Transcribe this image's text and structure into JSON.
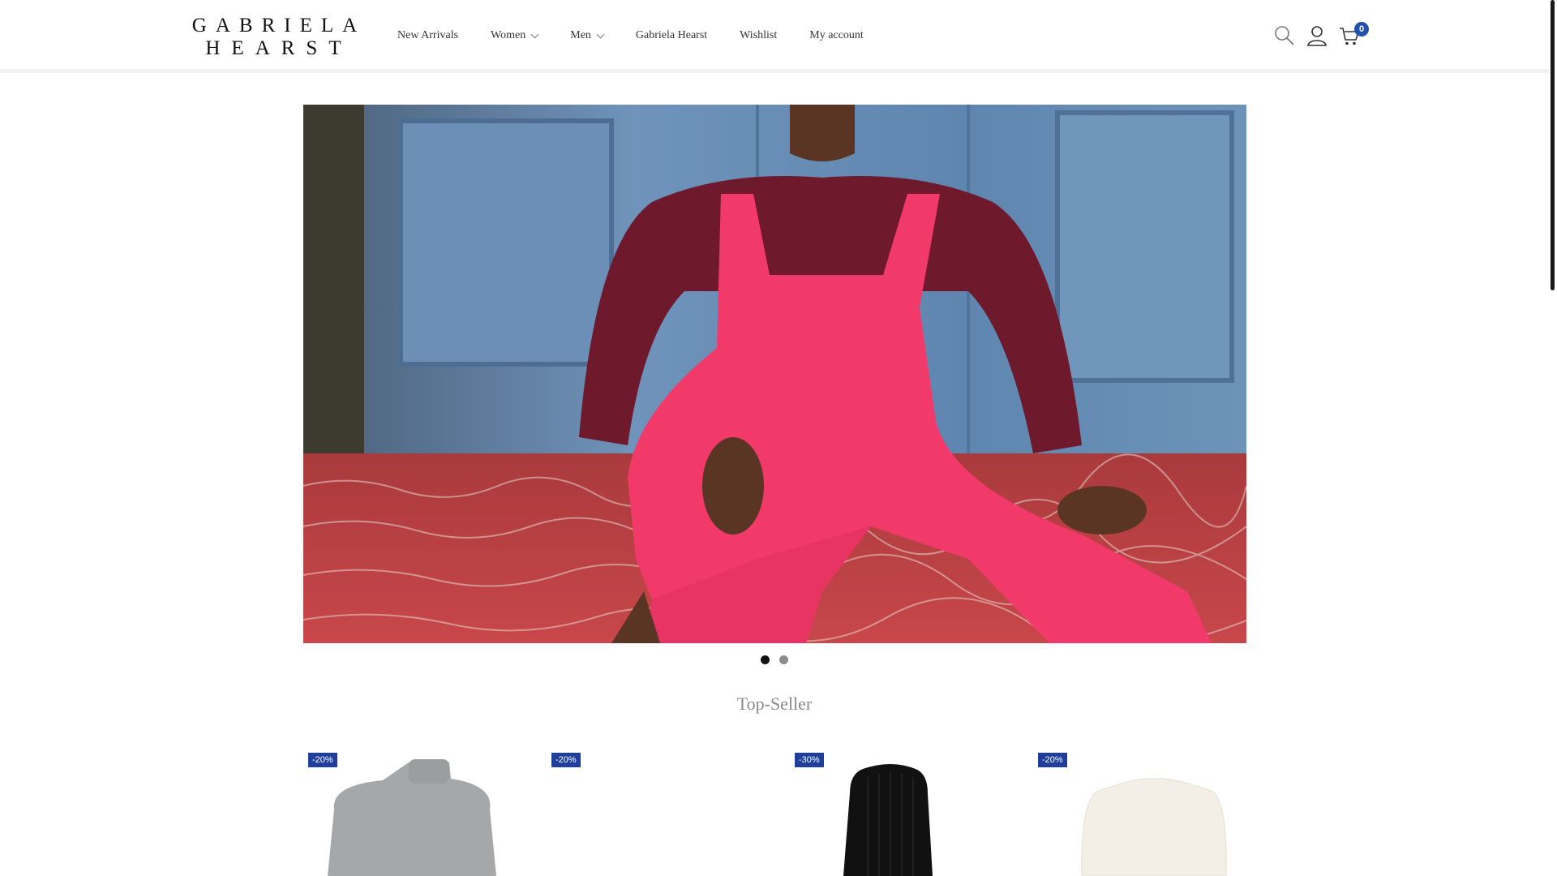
{
  "brand": {
    "logo_line1": "GABRIELA",
    "logo_line2": "HEARST"
  },
  "nav": {
    "items": [
      {
        "label": "New Arrivals",
        "has_dropdown": false
      },
      {
        "label": "Women",
        "has_dropdown": true
      },
      {
        "label": "Men",
        "has_dropdown": true
      },
      {
        "label": "Gabriela Hearst",
        "has_dropdown": false
      },
      {
        "label": "Wishlist",
        "has_dropdown": false
      },
      {
        "label": "My account",
        "has_dropdown": false
      }
    ]
  },
  "header_icons": {
    "search": "search-icon",
    "account": "user-icon",
    "cart": "cart-icon",
    "cart_count": "0"
  },
  "hero": {
    "slides_total": 2,
    "active_slide": 1
  },
  "section": {
    "title": "Top-Seller"
  },
  "products": [
    {
      "badge": "-20%",
      "image": "grey-turtleneck"
    },
    {
      "badge": "-20%",
      "image": "blank"
    },
    {
      "badge": "-30%",
      "image": "black-knit-dress"
    },
    {
      "badge": "-20%",
      "image": "ivory-sweater"
    }
  ],
  "colors": {
    "accent": "#2250ad",
    "badge": "#1f3f9a",
    "title": "#8a8a8a"
  }
}
